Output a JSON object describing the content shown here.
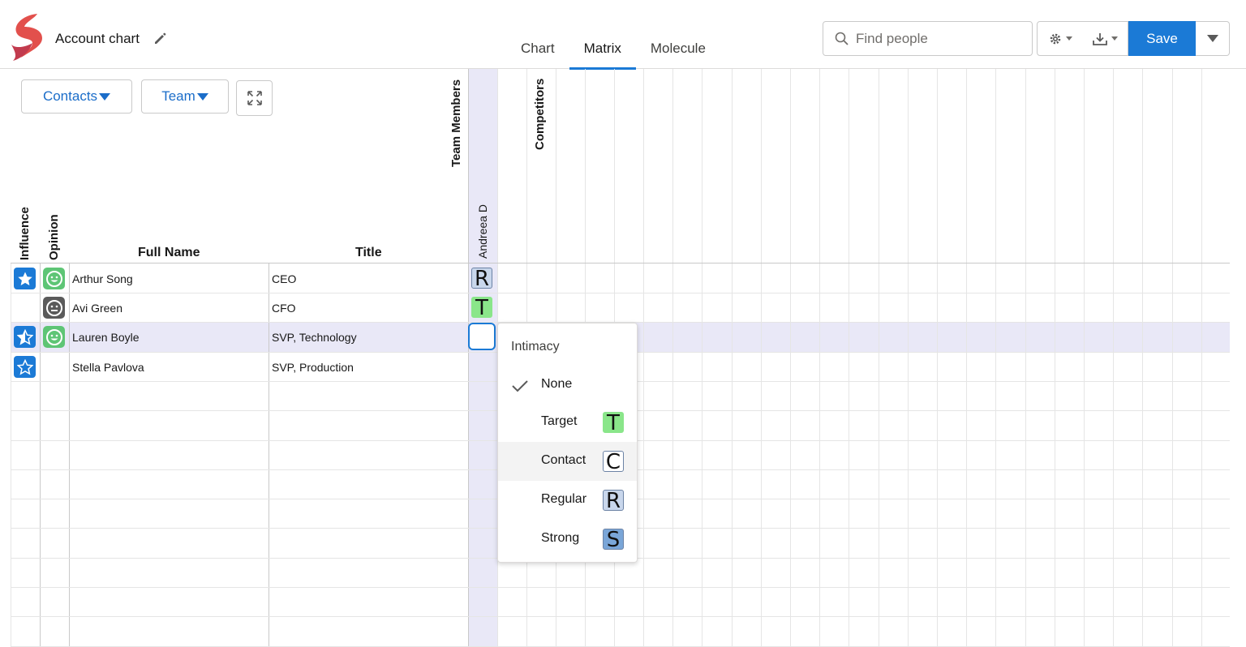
{
  "app": {
    "title": "Account chart"
  },
  "tabs": [
    {
      "label": "Chart",
      "active": false
    },
    {
      "label": "Matrix",
      "active": true
    },
    {
      "label": "Molecule",
      "active": false
    }
  ],
  "search": {
    "placeholder": "Find people"
  },
  "toolbar": {
    "save_label": "Save"
  },
  "filters": {
    "contacts_label": "Contacts",
    "team_label": "Team"
  },
  "columns": {
    "influence": "Influence",
    "opinion": "Opinion",
    "full_name": "Full Name",
    "title": "Title",
    "team_members": "Team Members",
    "competitors": "Competitors",
    "member": "Andreea D"
  },
  "rows": [
    {
      "name": "Arthur Song",
      "title": "CEO",
      "influence": "star-filled",
      "opinion": "positive",
      "intimacy": "R"
    },
    {
      "name": "Avi Green",
      "title": "CFO",
      "influence": "none",
      "opinion": "neutral",
      "intimacy": "T"
    },
    {
      "name": "Lauren Boyle",
      "title": "SVP, Technology",
      "influence": "star-half",
      "opinion": "positive",
      "intimacy": ""
    },
    {
      "name": "Stella Pavlova",
      "title": "SVP, Production",
      "influence": "star-outline",
      "opinion": "none",
      "intimacy": ""
    }
  ],
  "intimacy_menu": {
    "title": "Intimacy",
    "items": [
      {
        "label": "None",
        "code": "",
        "selected": true
      },
      {
        "label": "Target",
        "code": "T"
      },
      {
        "label": "Contact",
        "code": "C"
      },
      {
        "label": "Regular",
        "code": "R"
      },
      {
        "label": "Strong",
        "code": "S"
      }
    ]
  },
  "colors": {
    "accent": "#1b7ad6",
    "team_highlight": "#e9e8f7",
    "target_green": "#8ae68a",
    "positive_green": "#5ec575"
  }
}
